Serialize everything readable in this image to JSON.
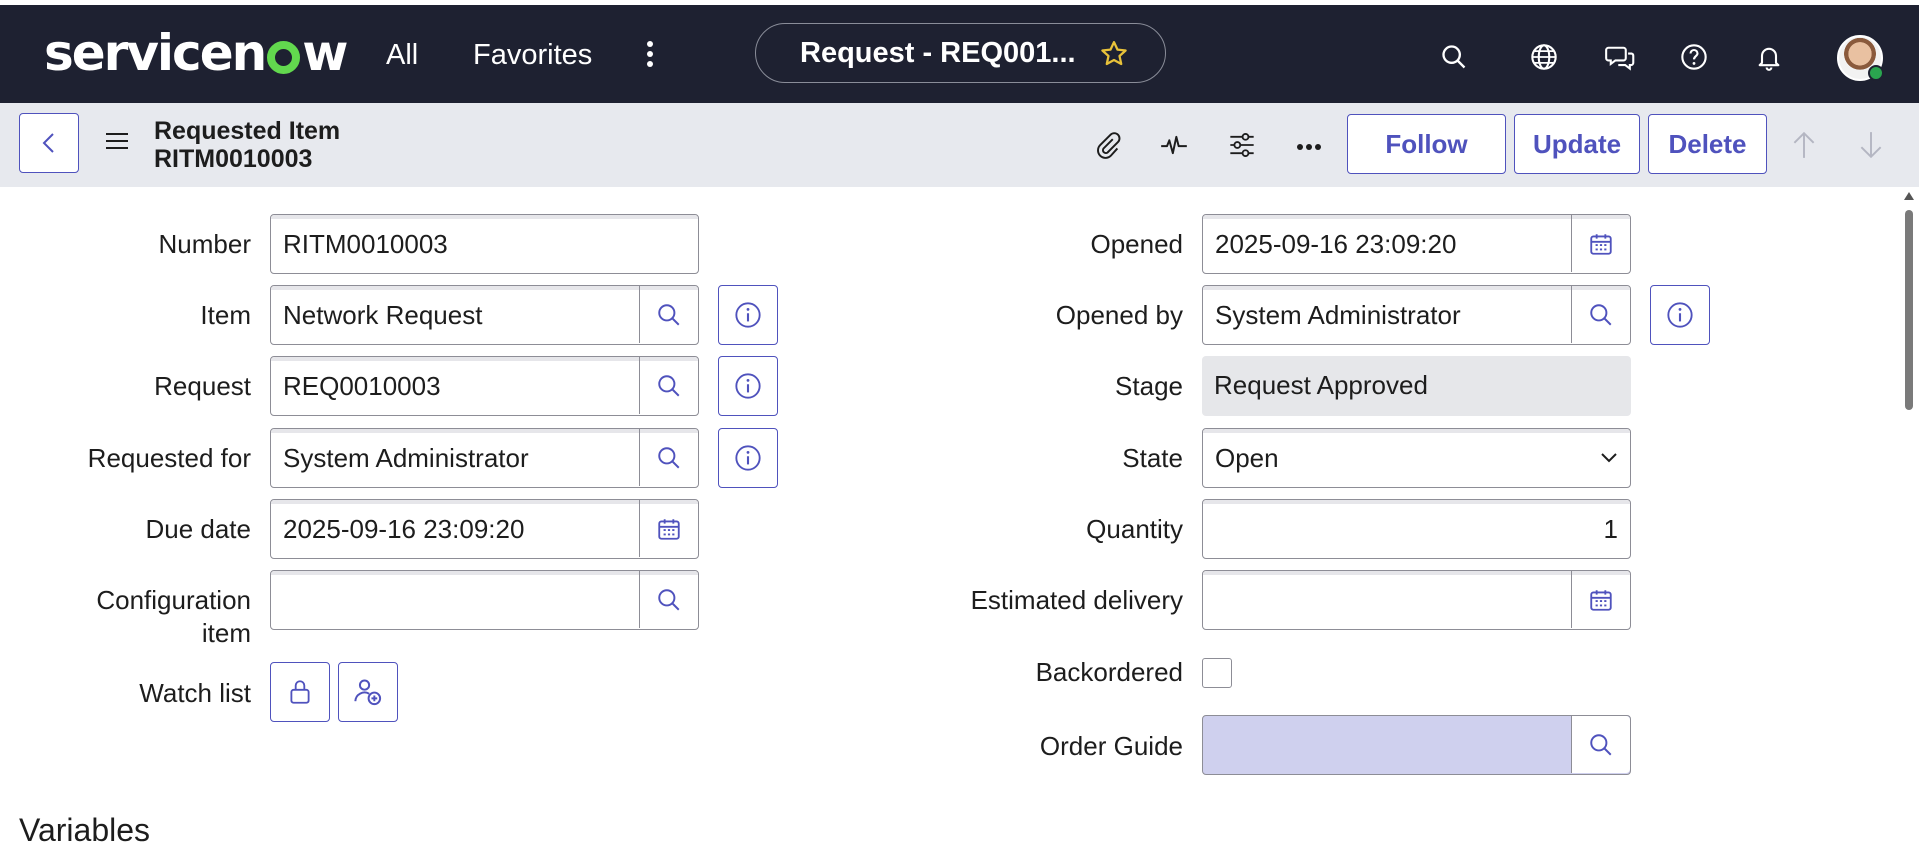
{
  "topnav": {
    "logo": "servicenow",
    "all_label": "All",
    "favorites_label": "Favorites",
    "title": "Request - REQ001...",
    "icons": [
      "search-icon",
      "globe-icon",
      "chat-icon",
      "help-icon",
      "bell-icon",
      "avatar"
    ]
  },
  "header": {
    "record_type": "Requested Item",
    "record_number": "RITM0010003",
    "follow_label": "Follow",
    "update_label": "Update",
    "delete_label": "Delete"
  },
  "form": {
    "left": {
      "number": {
        "label": "Number",
        "value": "RITM0010003"
      },
      "item": {
        "label": "Item",
        "value": "Network Request"
      },
      "request": {
        "label": "Request",
        "value": "REQ0010003"
      },
      "requested_for": {
        "label": "Requested for",
        "value": "System Administrator"
      },
      "due_date": {
        "label": "Due date",
        "value": "2025-09-16 23:09:20"
      },
      "configuration_item": {
        "label_line1": "Configuration",
        "label_line2": "item",
        "value": ""
      },
      "watch_list": {
        "label": "Watch list"
      }
    },
    "right": {
      "opened": {
        "label": "Opened",
        "value": "2025-09-16 23:09:20"
      },
      "opened_by": {
        "label": "Opened by",
        "value": "System Administrator"
      },
      "stage": {
        "label": "Stage",
        "value": "Request Approved"
      },
      "state": {
        "label": "State",
        "value": "Open"
      },
      "quantity": {
        "label": "Quantity",
        "value": "1"
      },
      "estimated_delivery": {
        "label": "Estimated delivery",
        "value": ""
      },
      "backordered": {
        "label": "Backordered",
        "checked": false
      },
      "order_guide": {
        "label": "Order Guide",
        "value": ""
      }
    }
  },
  "variables_title": "Variables",
  "colors": {
    "nav_bg": "#1e2131",
    "accent": "#4f52bd",
    "logo_green": "#62d84e",
    "subbar_bg": "#e7e9ee"
  }
}
